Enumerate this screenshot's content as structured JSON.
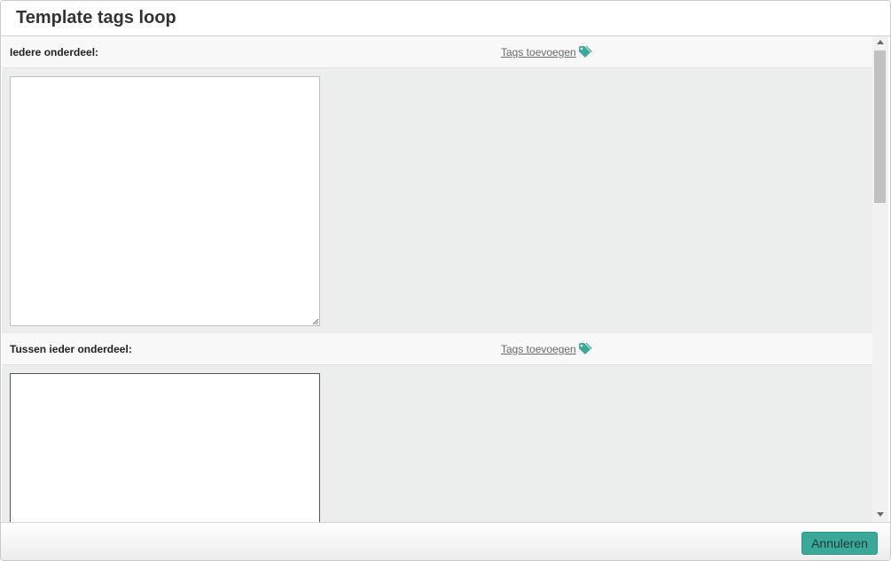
{
  "dialog": {
    "title": "Template tags loop",
    "cancel_label": "Annuleren"
  },
  "sections": [
    {
      "label": "Iedere onderdeel:",
      "link": "Tags toevoegen",
      "value": ""
    },
    {
      "label": "Tussen ieder onderdeel:",
      "link": "Tags toevoegen",
      "value": ""
    }
  ],
  "colors": {
    "accent": "#3aa99a",
    "body_bg": "#eceeed",
    "section_header_bg": "#f8f8f8"
  },
  "icons": {
    "tag": "tag-icon",
    "resize": "resize-grip-icon"
  }
}
